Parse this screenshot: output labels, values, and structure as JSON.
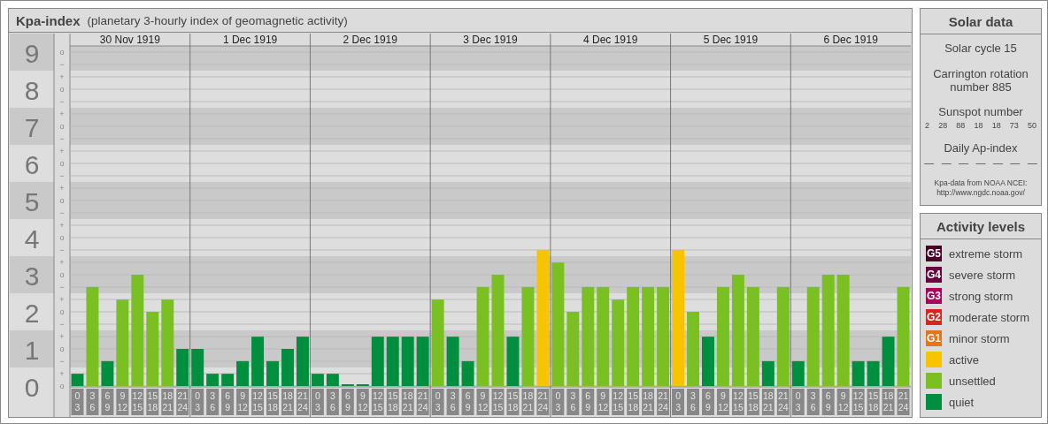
{
  "kp_panel": {
    "title": "Kpa-index",
    "subtitle": "(planetary 3-hourly index of geomagnetic activity)",
    "minor_scale": [
      "o",
      "−",
      "+",
      "o",
      "−",
      "+",
      "o",
      "−",
      "+",
      "o",
      "−",
      "+",
      "o",
      "−",
      "+",
      "o",
      "−",
      "+",
      "o",
      "−",
      "+",
      "o",
      "−",
      "+",
      "o",
      "−",
      "+",
      "o"
    ],
    "days": [
      "30 Nov 1919",
      "1 Dec 1919",
      "2 Dec 1919",
      "3 Dec 1919",
      "4 Dec 1919",
      "5 Dec 1919",
      "6 Dec 1919"
    ],
    "chart_data": {
      "type": "bar",
      "ylim": [
        0,
        9
      ],
      "yticks": [
        0,
        1,
        2,
        3,
        4,
        5,
        6,
        7,
        8,
        9
      ],
      "grid": true,
      "categories": [
        "0 3",
        "3 6",
        "6 9",
        "9 12",
        "12 15",
        "15 18",
        "18 21",
        "21 24",
        "0 3",
        "3 6",
        "6 9",
        "9 12",
        "12 15",
        "15 18",
        "18 21",
        "21 24",
        "0 3",
        "3 6",
        "6 9",
        "9 12",
        "12 15",
        "15 18",
        "18 21",
        "21 24",
        "0 3",
        "3 6",
        "6 9",
        "9 12",
        "12 15",
        "15 18",
        "18 21",
        "21 24",
        "0 3",
        "3 6",
        "6 9",
        "9 12",
        "12 15",
        "15 18",
        "18 21",
        "21 24",
        "0 3",
        "3 6",
        "6 9",
        "9 12",
        "12 15",
        "15 18",
        "18 21",
        "21 24",
        "0 3",
        "3 6",
        "6 9",
        "9 12",
        "12 15",
        "15 18",
        "18 21",
        "21 24"
      ],
      "values": [
        0.33,
        2.67,
        0.67,
        2.33,
        3,
        2,
        2.33,
        1,
        1,
        0.33,
        0.33,
        0.67,
        1.33,
        0.67,
        1,
        1.33,
        0.33,
        0.33,
        0,
        0,
        1.33,
        1.33,
        1.33,
        1.33,
        2.33,
        1.33,
        0.67,
        2.67,
        3,
        1.33,
        2.67,
        3.67,
        3.33,
        2,
        2.67,
        2.67,
        2.33,
        2.67,
        2.67,
        2.67,
        3.67,
        2,
        1.33,
        2.67,
        3,
        2.67,
        0.67,
        2.67,
        0.67,
        2.67,
        3,
        3,
        0.67,
        0.67,
        1.33,
        2.67
      ]
    }
  },
  "solar_data": {
    "title": "Solar data",
    "solar_cycle": "Solar cycle 15",
    "carrington": "Carrington rotation number 885",
    "sunspot_label": "Sunspot number",
    "sunspots": [
      "2",
      "28",
      "88",
      "18",
      "18",
      "73",
      "50"
    ],
    "ap_label": "Daily Ap-index",
    "ap_values": [
      "—",
      "—",
      "—",
      "—",
      "—",
      "—",
      "—"
    ],
    "source": "Kpa-data from NOAA NCEI:",
    "source_url": "http://www.ngdc.noaa.gov/"
  },
  "activity_levels": {
    "title": "Activity levels",
    "items": [
      {
        "badge": "G5",
        "label": "extreme storm",
        "color": "#4a0025"
      },
      {
        "badge": "G4",
        "label": "severe storm",
        "color": "#6c0040"
      },
      {
        "badge": "G3",
        "label": "strong storm",
        "color": "#a8005c"
      },
      {
        "badge": "G2",
        "label": "moderate storm",
        "color": "#d8261c"
      },
      {
        "badge": "G1",
        "label": "minor storm",
        "color": "#e8741a"
      },
      {
        "label": "active",
        "color": "#f8c400"
      },
      {
        "label": "unsettled",
        "color": "#7ac023"
      },
      {
        "label": "quiet",
        "color": "#008f3f"
      }
    ]
  }
}
